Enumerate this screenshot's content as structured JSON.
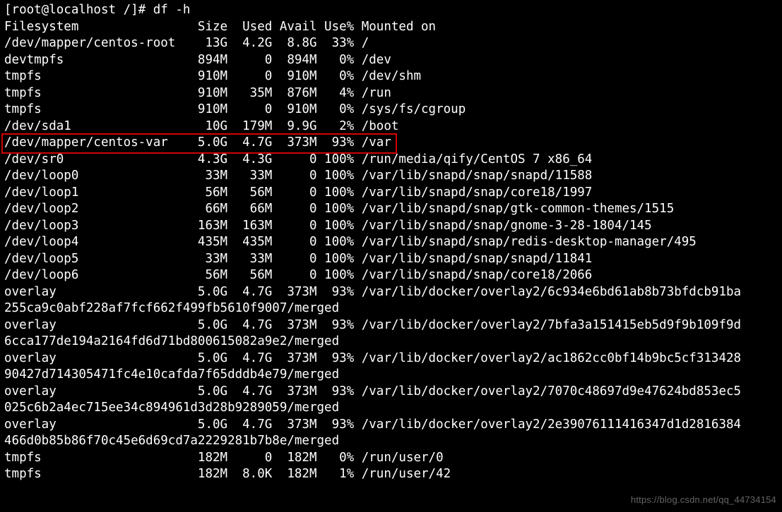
{
  "prompt": "[root@localhost /]# ",
  "command": "df -h",
  "header": {
    "filesystem": "Filesystem",
    "size": "Size",
    "used": "Used",
    "avail": "Avail",
    "usep": "Use%",
    "mounted": "Mounted on"
  },
  "rows": [
    {
      "fs": "/dev/mapper/centos-root",
      "size": "13G",
      "used": "4.2G",
      "avail": "8.8G",
      "usep": "33%",
      "mnt": "/"
    },
    {
      "fs": "devtmpfs",
      "size": "894M",
      "used": "0",
      "avail": "894M",
      "usep": "0%",
      "mnt": "/dev"
    },
    {
      "fs": "tmpfs",
      "size": "910M",
      "used": "0",
      "avail": "910M",
      "usep": "0%",
      "mnt": "/dev/shm"
    },
    {
      "fs": "tmpfs",
      "size": "910M",
      "used": "35M",
      "avail": "876M",
      "usep": "4%",
      "mnt": "/run"
    },
    {
      "fs": "tmpfs",
      "size": "910M",
      "used": "0",
      "avail": "910M",
      "usep": "0%",
      "mnt": "/sys/fs/cgroup"
    },
    {
      "fs": "/dev/sda1",
      "size": "10G",
      "used": "179M",
      "avail": "9.9G",
      "usep": "2%",
      "mnt": "/boot"
    },
    {
      "fs": "/dev/mapper/centos-var",
      "size": "5.0G",
      "used": "4.7G",
      "avail": "373M",
      "usep": "93%",
      "mnt": "/var"
    },
    {
      "fs": "/dev/sr0",
      "size": "4.3G",
      "used": "4.3G",
      "avail": "0",
      "usep": "100%",
      "mnt": "/run/media/qify/CentOS 7 x86_64"
    },
    {
      "fs": "/dev/loop0",
      "size": "33M",
      "used": "33M",
      "avail": "0",
      "usep": "100%",
      "mnt": "/var/lib/snapd/snap/snapd/11588"
    },
    {
      "fs": "/dev/loop1",
      "size": "56M",
      "used": "56M",
      "avail": "0",
      "usep": "100%",
      "mnt": "/var/lib/snapd/snap/core18/1997"
    },
    {
      "fs": "/dev/loop2",
      "size": "66M",
      "used": "66M",
      "avail": "0",
      "usep": "100%",
      "mnt": "/var/lib/snapd/snap/gtk-common-themes/1515"
    },
    {
      "fs": "/dev/loop3",
      "size": "163M",
      "used": "163M",
      "avail": "0",
      "usep": "100%",
      "mnt": "/var/lib/snapd/snap/gnome-3-28-1804/145"
    },
    {
      "fs": "/dev/loop4",
      "size": "435M",
      "used": "435M",
      "avail": "0",
      "usep": "100%",
      "mnt": "/var/lib/snapd/snap/redis-desktop-manager/495"
    },
    {
      "fs": "/dev/loop5",
      "size": "33M",
      "used": "33M",
      "avail": "0",
      "usep": "100%",
      "mnt": "/var/lib/snapd/snap/snapd/11841"
    },
    {
      "fs": "/dev/loop6",
      "size": "56M",
      "used": "56M",
      "avail": "0",
      "usep": "100%",
      "mnt": "/var/lib/snapd/snap/core18/2066"
    },
    {
      "fs": "overlay",
      "size": "5.0G",
      "used": "4.7G",
      "avail": "373M",
      "usep": "93%",
      "mnt": "/var/lib/docker/overlay2/6c934e6bd61ab8b73bfdcb91ba255ca9c0abf228af7fcf662f499fb5610f9007/merged"
    },
    {
      "fs": "overlay",
      "size": "5.0G",
      "used": "4.7G",
      "avail": "373M",
      "usep": "93%",
      "mnt": "/var/lib/docker/overlay2/7bfa3a151415eb5d9f9b109f9d6cca177de194a2164fd6d71bd800615082a9e2/merged"
    },
    {
      "fs": "overlay",
      "size": "5.0G",
      "used": "4.7G",
      "avail": "373M",
      "usep": "93%",
      "mnt": "/var/lib/docker/overlay2/ac1862cc0bf14b9bc5cf31342890427d714305471fc4e10cafda7f65dddb4e79/merged"
    },
    {
      "fs": "overlay",
      "size": "5.0G",
      "used": "4.7G",
      "avail": "373M",
      "usep": "93%",
      "mnt": "/var/lib/docker/overlay2/7070c48697d9e47624bd853ec5025c6b2a4ec715ee34c894961d3d28b9289059/merged"
    },
    {
      "fs": "overlay",
      "size": "5.0G",
      "used": "4.7G",
      "avail": "373M",
      "usep": "93%",
      "mnt": "/var/lib/docker/overlay2/2e39076111416347d1d2816384466d0b85b86f70c45e6d69cd7a2229281b7b8e/merged"
    },
    {
      "fs": "tmpfs",
      "size": "182M",
      "used": "0",
      "avail": "182M",
      "usep": "0%",
      "mnt": "/run/user/0"
    },
    {
      "fs": "tmpfs",
      "size": "182M",
      "used": "8.0K",
      "avail": "182M",
      "usep": "1%",
      "mnt": "/run/user/42"
    }
  ],
  "terminal_width": 99,
  "highlighted_row_index": 6,
  "watermark": "https://blog.csdn.net/qq_44734154"
}
